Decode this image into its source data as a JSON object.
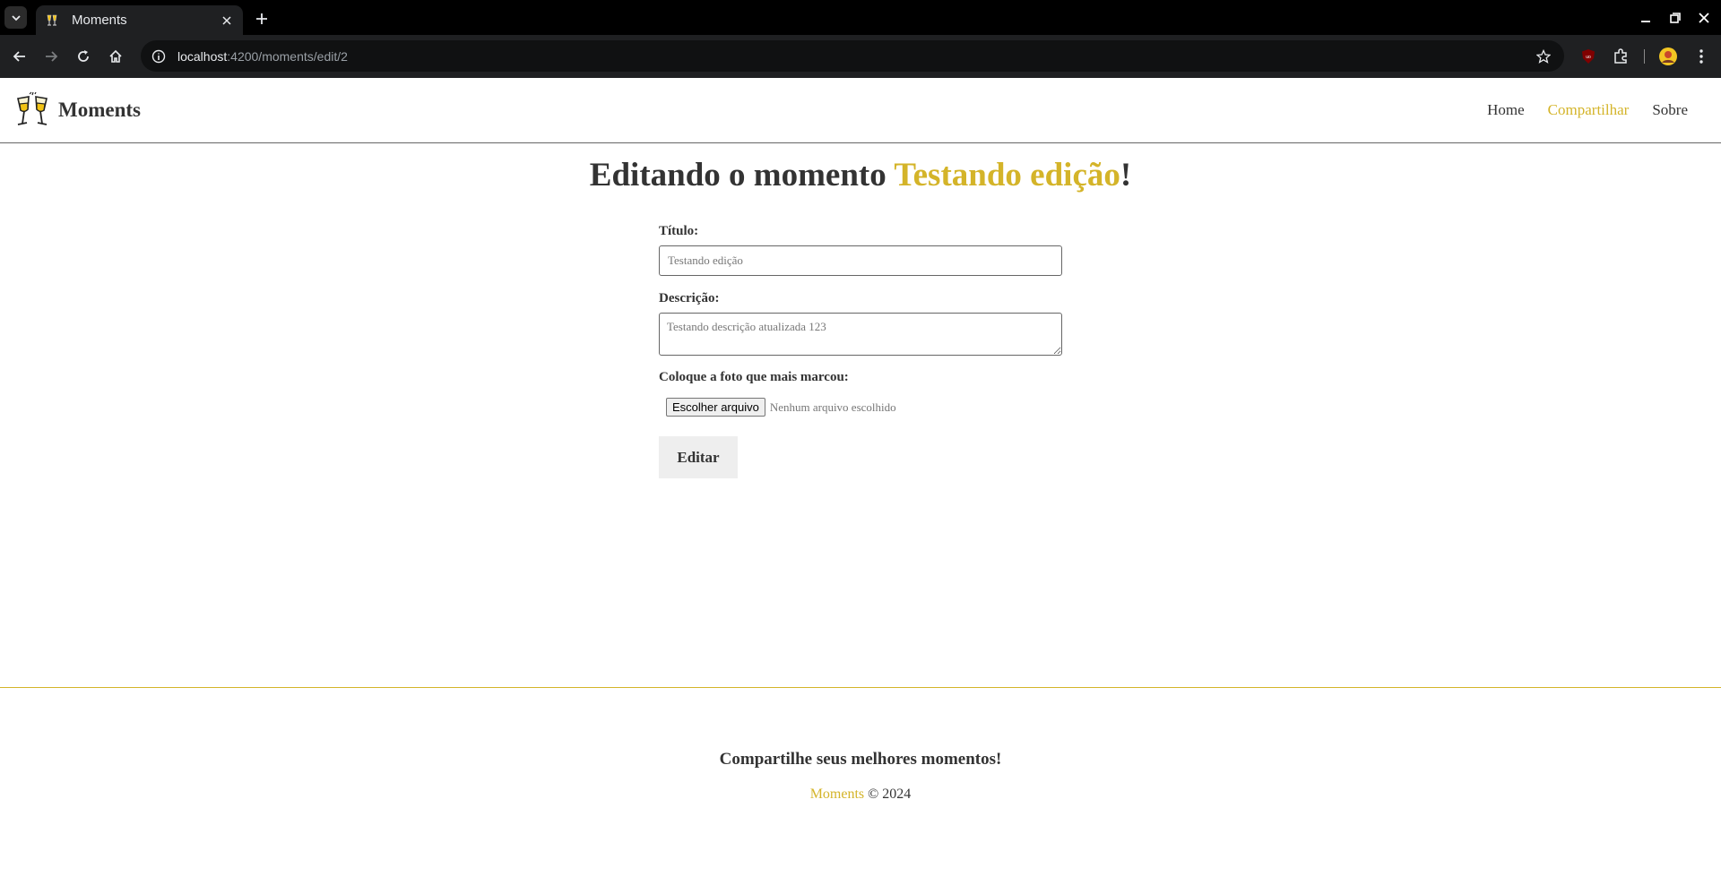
{
  "browser": {
    "tab_title": "Moments",
    "url_host": "localhost",
    "url_path": ":4200/moments/edit/2",
    "colors": {
      "tabstrip": "#000000",
      "toolbar": "#1f2022",
      "omnibox": "#101112"
    },
    "icons": [
      "tab-search-icon",
      "moments-favicon",
      "close-icon",
      "plus-icon",
      "minimize-icon",
      "restore-icon",
      "close-window-icon",
      "back-icon",
      "forward-icon",
      "reload-icon",
      "home-icon",
      "site-info-icon",
      "star-icon",
      "ublock-icon",
      "extensions-icon",
      "profile-icon",
      "kebab-menu-icon"
    ]
  },
  "header": {
    "brand": "Moments",
    "nav": [
      {
        "label": "Home",
        "active": false
      },
      {
        "label": "Compartilhar",
        "active": true
      },
      {
        "label": "Sobre",
        "active": false
      }
    ]
  },
  "main": {
    "title_prefix": "Editando o momento ",
    "title_highlight": "Testando edição",
    "title_suffix": "!"
  },
  "form": {
    "title_label": "Título:",
    "title_value": "Testando edição",
    "description_label": "Descrição:",
    "description_value": "Testando descrição atualizada 123",
    "photo_label": "Coloque a foto que mais marcou:",
    "file_button": "Escolher arquivo",
    "file_status": "Nenhum arquivo escolhido",
    "submit_label": "Editar"
  },
  "footer": {
    "tagline": "Compartilhe seus melhores momentos!",
    "brand": "Moments",
    "copyright": " © 2024"
  },
  "colors": {
    "accent": "#d4b429",
    "text": "#333333"
  }
}
